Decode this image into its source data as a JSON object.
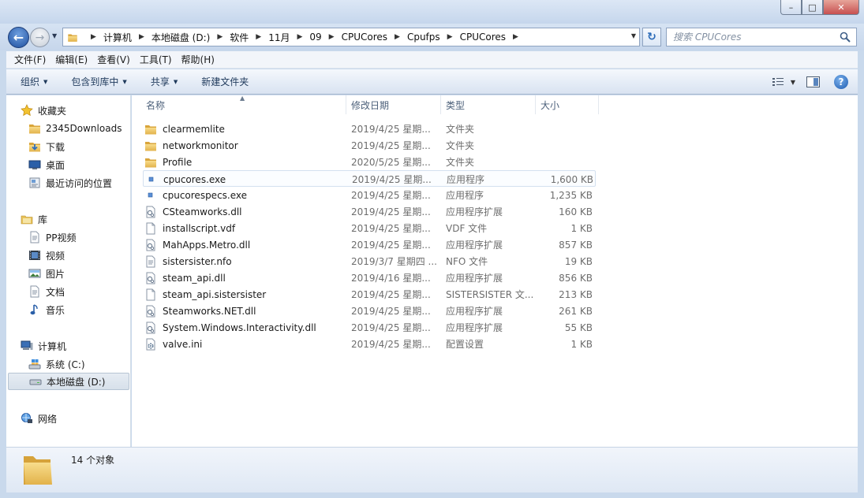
{
  "window": {
    "caption": {
      "minimize": "–",
      "maximize": "□",
      "close": "✕"
    }
  },
  "address": {
    "breadcrumbs": [
      "计算机",
      "本地磁盘 (D:)",
      "软件",
      "11月",
      "09",
      "CPUCores",
      "Cpufps",
      "CPUCores"
    ],
    "search_placeholder": "搜索 CPUCores"
  },
  "menu": [
    "文件(F)",
    "编辑(E)",
    "查看(V)",
    "工具(T)",
    "帮助(H)"
  ],
  "toolbar": {
    "organize": "组织",
    "include_in_library": "包含到库中",
    "share": "共享",
    "new_folder": "新建文件夹"
  },
  "nav": {
    "favorites": "收藏夹",
    "fav_items": [
      "2345Downloads",
      "下载",
      "桌面",
      "最近访问的位置"
    ],
    "libraries": "库",
    "lib_items": [
      "PP视频",
      "视频",
      "图片",
      "文档",
      "音乐"
    ],
    "computer": "计算机",
    "drives": [
      "系统 (C:)",
      "本地磁盘 (D:)"
    ],
    "network": "网络"
  },
  "columns": {
    "name": "名称",
    "date": "修改日期",
    "type": "类型",
    "size": "大小"
  },
  "files": [
    {
      "name": "clearmemlite",
      "date": "2019/4/25 星期...",
      "type": "文件夹",
      "size": "",
      "icon": "folder-icon"
    },
    {
      "name": "networkmonitor",
      "date": "2019/4/25 星期...",
      "type": "文件夹",
      "size": "",
      "icon": "folder-icon"
    },
    {
      "name": "Profile",
      "date": "2020/5/25 星期...",
      "type": "文件夹",
      "size": "",
      "icon": "folder-icon"
    },
    {
      "name": "cpucores.exe",
      "date": "2019/4/25 星期...",
      "type": "应用程序",
      "size": "1,600 KB",
      "icon": "exe-icon"
    },
    {
      "name": "cpucorespecs.exe",
      "date": "2019/4/25 星期...",
      "type": "应用程序",
      "size": "1,235 KB",
      "icon": "exe-icon"
    },
    {
      "name": "CSteamworks.dll",
      "date": "2019/4/25 星期...",
      "type": "应用程序扩展",
      "size": "160 KB",
      "icon": "dll-icon"
    },
    {
      "name": "installscript.vdf",
      "date": "2019/4/25 星期...",
      "type": "VDF 文件",
      "size": "1 KB",
      "icon": "file-icon"
    },
    {
      "name": "MahApps.Metro.dll",
      "date": "2019/4/25 星期...",
      "type": "应用程序扩展",
      "size": "857 KB",
      "icon": "dll-icon"
    },
    {
      "name": "sistersister.nfo",
      "date": "2019/3/7 星期四 ...",
      "type": "NFO 文件",
      "size": "19 KB",
      "icon": "nfo-icon"
    },
    {
      "name": "steam_api.dll",
      "date": "2019/4/16 星期...",
      "type": "应用程序扩展",
      "size": "856 KB",
      "icon": "dll-icon"
    },
    {
      "name": "steam_api.sistersister",
      "date": "2019/4/25 星期...",
      "type": "SISTERSISTER 文...",
      "size": "213 KB",
      "icon": "file-icon"
    },
    {
      "name": "Steamworks.NET.dll",
      "date": "2019/4/25 星期...",
      "type": "应用程序扩展",
      "size": "261 KB",
      "icon": "dll-icon"
    },
    {
      "name": "System.Windows.Interactivity.dll",
      "date": "2019/4/25 星期...",
      "type": "应用程序扩展",
      "size": "55 KB",
      "icon": "dll-icon"
    },
    {
      "name": "valve.ini",
      "date": "2019/4/25 星期...",
      "type": "配置设置",
      "size": "1 KB",
      "icon": "ini-icon"
    }
  ],
  "details": {
    "count": "14 个对象"
  }
}
